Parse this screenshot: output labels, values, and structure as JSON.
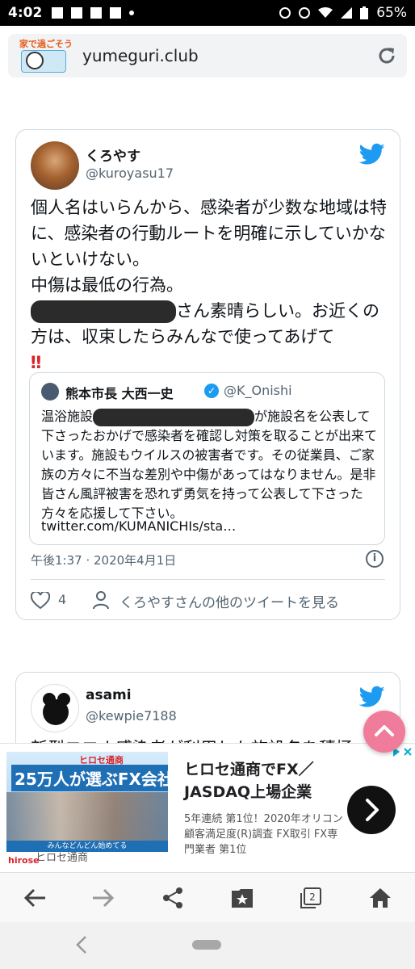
{
  "status_bar": {
    "time": "4:02",
    "battery": "65%"
  },
  "address_bar": {
    "logo_text": "家で過ごそう",
    "url": "yumeguri.club"
  },
  "tweet1": {
    "name": "くろやす",
    "handle": "@kuroyasu17",
    "text_line1": "個人名はいらんから、感染者が少数な地域は特に、感染者の行動ルートを明確に示していかないといけない。",
    "text_line2": "中傷は最低の行為。",
    "text_line3": "さん素晴らしい。お近くの方は、収束したらみんなで使ってあげて",
    "emoji": "‼",
    "quote": {
      "name": "熊本市長 大西一史",
      "verified_mark": "✓",
      "handle": "@K_Onishi",
      "text_prefix": "温浴施設",
      "text_suffix": "が施設名を公表して下さったおかげで感染者を確認し対策を取ることが出来ています。施設もウイルスの被害者です。その従業員、ご家族の方々に不当な差別や中傷があってはなりません。是非皆さん風評被害を恐れず勇気を持って公表して下さった方々を応援して下さい。",
      "link": "twitter.com/KUMANICHIs/sta…"
    },
    "timestamp": "午後1:37 · 2020年4月1日",
    "info": "i",
    "likes": "4",
    "more_tweets": "くろやすさんの他のツイートを見る"
  },
  "tweet2": {
    "name": "asami",
    "handle": "@kewpie7188",
    "text_partial": "新型コロナ感染者が利用した施設名を積極"
  },
  "ad": {
    "image_brand": "ヒロセ通商",
    "image_headline": "25万人が選ぶFX会社",
    "image_tagline": "みんなどんどん始めてる",
    "logo": "hirose",
    "advertiser": "ヒロセ通商",
    "title": "ヒロセ通商でFX／JASDAQ上場企業",
    "description": "5年連続 第1位！2020年オリコン顧客満足度(R)調査 FX取引 FX専門業者 第1位"
  },
  "toolbar": {
    "tab_count": "2"
  },
  "colors": {
    "twitter_blue": "#1d9bf0",
    "scroll_top_pink": "#f07c9b",
    "ad_headline_blue": "#1f6fb5"
  },
  "icons": [
    "wifi-icon",
    "signal-icon",
    "battery-icon",
    "alarm-icon",
    "location-icon",
    "reload-icon",
    "twitter-bird-icon",
    "heart-icon",
    "person-icon",
    "info-icon",
    "chevron-up-icon",
    "chevron-right-icon",
    "back-arrow-icon",
    "forward-arrow-icon",
    "share-icon",
    "bookmark-star-icon",
    "tabs-icon",
    "home-icon"
  ]
}
